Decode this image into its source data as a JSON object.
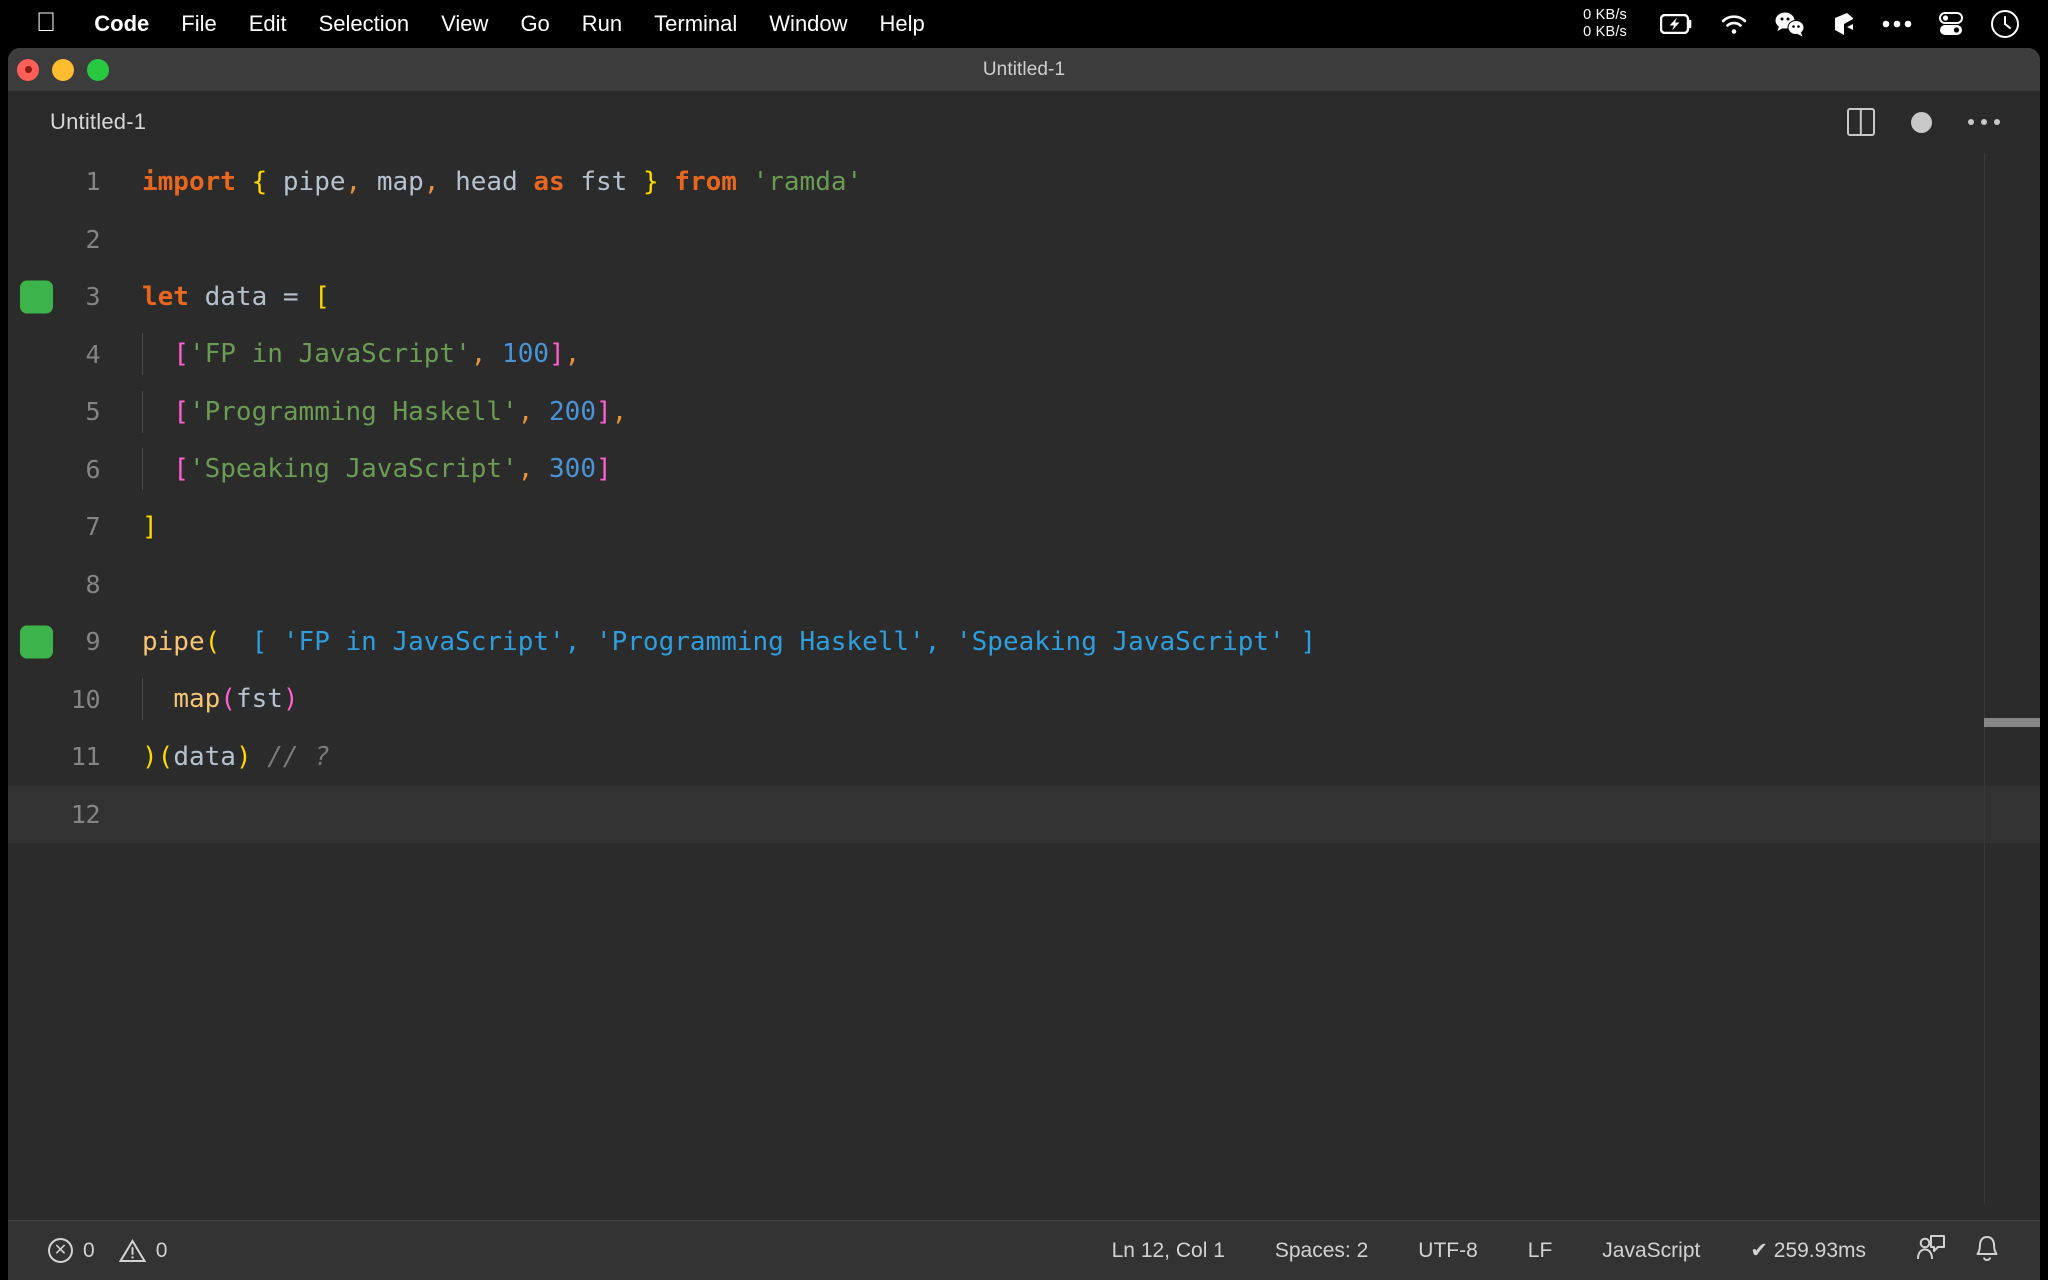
{
  "menubar": {
    "apple_icon": "apple-logo-icon",
    "items": [
      {
        "label": "Code",
        "bold": true
      },
      {
        "label": "File",
        "bold": false
      },
      {
        "label": "Edit",
        "bold": false
      },
      {
        "label": "Selection",
        "bold": false
      },
      {
        "label": "View",
        "bold": false
      },
      {
        "label": "Go",
        "bold": false
      },
      {
        "label": "Run",
        "bold": false
      },
      {
        "label": "Terminal",
        "bold": false
      },
      {
        "label": "Window",
        "bold": false
      },
      {
        "label": "Help",
        "bold": false
      }
    ],
    "network_speed": "0 KB/s\n0 KB/s",
    "status_icons": [
      "battery-charging-icon",
      "wifi-icon",
      "wechat-icon",
      "shape-icon",
      "ellipsis-icon",
      "toggles-icon",
      "control-center-clock-icon"
    ]
  },
  "window": {
    "title": "Untitled-1",
    "traffic_lights": [
      "close-button",
      "minimize-button",
      "maximize-button"
    ]
  },
  "tabbar": {
    "active_tab": "Untitled-1",
    "actions": [
      "split-editor-icon",
      "unsaved-dot-icon",
      "more-actions-icon"
    ]
  },
  "editor": {
    "language": "JavaScript",
    "current_line": 12,
    "lines": [
      {
        "n": "1",
        "marker": false,
        "cur": false,
        "guide": false,
        "tokens": [
          {
            "t": "import",
            "c": "kw"
          },
          {
            "t": " ",
            "c": "var"
          },
          {
            "t": "{",
            "c": "br-y"
          },
          {
            "t": " ",
            "c": "var"
          },
          {
            "t": "pipe",
            "c": "var"
          },
          {
            "t": ",",
            "c": "punc"
          },
          {
            "t": " ",
            "c": "var"
          },
          {
            "t": "map",
            "c": "var"
          },
          {
            "t": ",",
            "c": "punc"
          },
          {
            "t": " ",
            "c": "var"
          },
          {
            "t": "head",
            "c": "var"
          },
          {
            "t": " ",
            "c": "var"
          },
          {
            "t": "as",
            "c": "kw"
          },
          {
            "t": " ",
            "c": "var"
          },
          {
            "t": "fst",
            "c": "var"
          },
          {
            "t": " ",
            "c": "var"
          },
          {
            "t": "}",
            "c": "br-y"
          },
          {
            "t": " ",
            "c": "var"
          },
          {
            "t": "from",
            "c": "kw"
          },
          {
            "t": " ",
            "c": "var"
          },
          {
            "t": "'ramda'",
            "c": "str"
          }
        ]
      },
      {
        "n": "2",
        "marker": false,
        "cur": false,
        "guide": false,
        "tokens": []
      },
      {
        "n": "3",
        "marker": true,
        "cur": false,
        "guide": false,
        "tokens": [
          {
            "t": "let",
            "c": "kw"
          },
          {
            "t": " ",
            "c": "var"
          },
          {
            "t": "data",
            "c": "var"
          },
          {
            "t": " = ",
            "c": "var"
          },
          {
            "t": "[",
            "c": "br-y"
          }
        ]
      },
      {
        "n": "4",
        "marker": false,
        "cur": false,
        "guide": true,
        "tokens": [
          {
            "t": "  ",
            "c": "var"
          },
          {
            "t": "[",
            "c": "br-p"
          },
          {
            "t": "'FP in JavaScript'",
            "c": "str"
          },
          {
            "t": ",",
            "c": "punc"
          },
          {
            "t": " ",
            "c": "var"
          },
          {
            "t": "100",
            "c": "num"
          },
          {
            "t": "]",
            "c": "br-p"
          },
          {
            "t": ",",
            "c": "punc"
          }
        ]
      },
      {
        "n": "5",
        "marker": false,
        "cur": false,
        "guide": true,
        "tokens": [
          {
            "t": "  ",
            "c": "var"
          },
          {
            "t": "[",
            "c": "br-p"
          },
          {
            "t": "'Programming Haskell'",
            "c": "str"
          },
          {
            "t": ",",
            "c": "punc"
          },
          {
            "t": " ",
            "c": "var"
          },
          {
            "t": "200",
            "c": "num"
          },
          {
            "t": "]",
            "c": "br-p"
          },
          {
            "t": ",",
            "c": "punc"
          }
        ]
      },
      {
        "n": "6",
        "marker": false,
        "cur": false,
        "guide": true,
        "tokens": [
          {
            "t": "  ",
            "c": "var"
          },
          {
            "t": "[",
            "c": "br-p"
          },
          {
            "t": "'Speaking JavaScript'",
            "c": "str"
          },
          {
            "t": ",",
            "c": "punc"
          },
          {
            "t": " ",
            "c": "var"
          },
          {
            "t": "300",
            "c": "num"
          },
          {
            "t": "]",
            "c": "br-p"
          }
        ]
      },
      {
        "n": "7",
        "marker": false,
        "cur": false,
        "guide": false,
        "tokens": [
          {
            "t": "]",
            "c": "br-y"
          }
        ]
      },
      {
        "n": "8",
        "marker": false,
        "cur": false,
        "guide": false,
        "tokens": []
      },
      {
        "n": "9",
        "marker": true,
        "cur": false,
        "guide": false,
        "tokens": [
          {
            "t": "pipe",
            "c": "fn"
          },
          {
            "t": "(",
            "c": "br-y"
          },
          {
            "t": "  [ 'FP in JavaScript', 'Programming Haskell', 'Speaking JavaScript' ]",
            "c": "hint"
          }
        ]
      },
      {
        "n": "10",
        "marker": false,
        "cur": false,
        "guide": true,
        "tokens": [
          {
            "t": "  ",
            "c": "var"
          },
          {
            "t": "map",
            "c": "fn"
          },
          {
            "t": "(",
            "c": "br-p"
          },
          {
            "t": "fst",
            "c": "var"
          },
          {
            "t": ")",
            "c": "br-p"
          }
        ]
      },
      {
        "n": "11",
        "marker": false,
        "cur": false,
        "guide": false,
        "tokens": [
          {
            "t": ")",
            "c": "br-y"
          },
          {
            "t": "(",
            "c": "br-y"
          },
          {
            "t": "data",
            "c": "var"
          },
          {
            "t": ")",
            "c": "br-y"
          },
          {
            "t": " ",
            "c": "var"
          },
          {
            "t": "// ?",
            "c": "cmt"
          }
        ]
      },
      {
        "n": "12",
        "marker": false,
        "cur": true,
        "guide": false,
        "tokens": []
      }
    ]
  },
  "statusbar": {
    "error_icon": "error-circle-icon",
    "error_count": "0",
    "warning_icon": "warning-triangle-icon",
    "warning_count": "0",
    "cursor_position": "Ln 12, Col 1",
    "indentation": "Spaces: 2",
    "encoding": "UTF-8",
    "eol": "LF",
    "language_mode": "JavaScript",
    "run_status": "✔ 259.93ms",
    "feedback_icon": "feedback-person-icon",
    "bell_icon": "notifications-bell-icon"
  },
  "colors": {
    "menubar_bg": "#000000",
    "titlebar_bg": "#3c3c3c",
    "editor_bg": "#2b2b2b",
    "current_line_bg": "#323232",
    "statusbar_bg": "#333333",
    "keyword": "#e8671f",
    "string": "#6a9c54",
    "number": "#4a94d6",
    "function": "#f7c473",
    "bracket_yellow": "#ffd900",
    "bracket_pink": "#ff5fd2",
    "punctuation": "#e8913c",
    "variable": "#b6c2cf",
    "comment": "#7a7a7a",
    "inline_hint": "#2f9ede",
    "gutter_marker_green": "#3cb44a",
    "line_number": "#858585"
  }
}
